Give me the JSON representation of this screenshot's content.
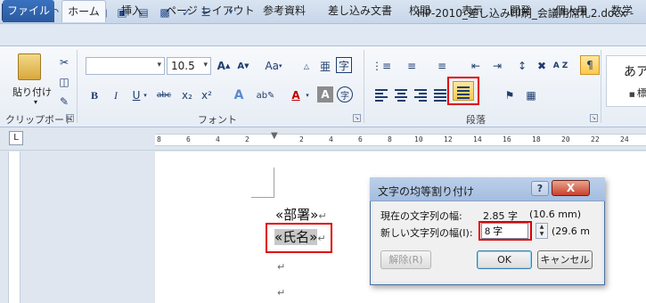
{
  "titlebar": {
    "app_icon": "W",
    "title": "HP-2010_差し込み印刷_会議用席札2.docx -"
  },
  "tabs": {
    "file": "ファイル",
    "home": "ホーム",
    "insert": "挿入",
    "page_layout": "ページ レイアウト",
    "references": "参考資料",
    "mailings": "差し込み文書",
    "review": "校閲",
    "view": "表示",
    "developer": "開発",
    "personal": "個人用",
    "math": "数学"
  },
  "ribbon": {
    "clipboard": {
      "paste_label": "貼り付け",
      "group_label": "クリップボード"
    },
    "font": {
      "font_name": "",
      "font_size": "10.5",
      "grow": "A",
      "shrink": "A",
      "change_case": "Aa",
      "bold": "B",
      "italic": "I",
      "underline": "U",
      "strikethrough": "abc",
      "subscript": "x₂",
      "superscript": "x²",
      "font_color": "A",
      "char_shading": "A",
      "enclose": "字",
      "ruby": "亜",
      "group_label": "フォント"
    },
    "paragraph": {
      "group_label": "段落",
      "sort": "A Z"
    },
    "styles": {
      "sample": "あア",
      "name": "標"
    }
  },
  "ruler": {
    "tab_selector": "L",
    "ticks": [
      "8",
      "6",
      "4",
      "2",
      "2",
      "4",
      "6",
      "8",
      "10",
      "12",
      "14",
      "16",
      "18",
      "20",
      "22",
      "24"
    ]
  },
  "document": {
    "dept_field": "«部署»",
    "name_field": "«氏名»",
    "return_mark": "↵"
  },
  "dialog": {
    "title": "文字の均等割り付け",
    "help": "?",
    "close": "X",
    "current_label": "現在の文字列の幅:",
    "current_value": "2.85 字",
    "current_mm": "(10.6 mm)",
    "new_label": "新しい文字列の幅(I):",
    "new_value": "8 字",
    "new_mm": "(29.6 m",
    "release_button": "解除(R)",
    "ok_button": "OK",
    "cancel_button": "キャンセル"
  },
  "colors": {
    "highlight_red": "#e00000",
    "file_tab": "#2b579a",
    "close_button": "#c9402b"
  }
}
